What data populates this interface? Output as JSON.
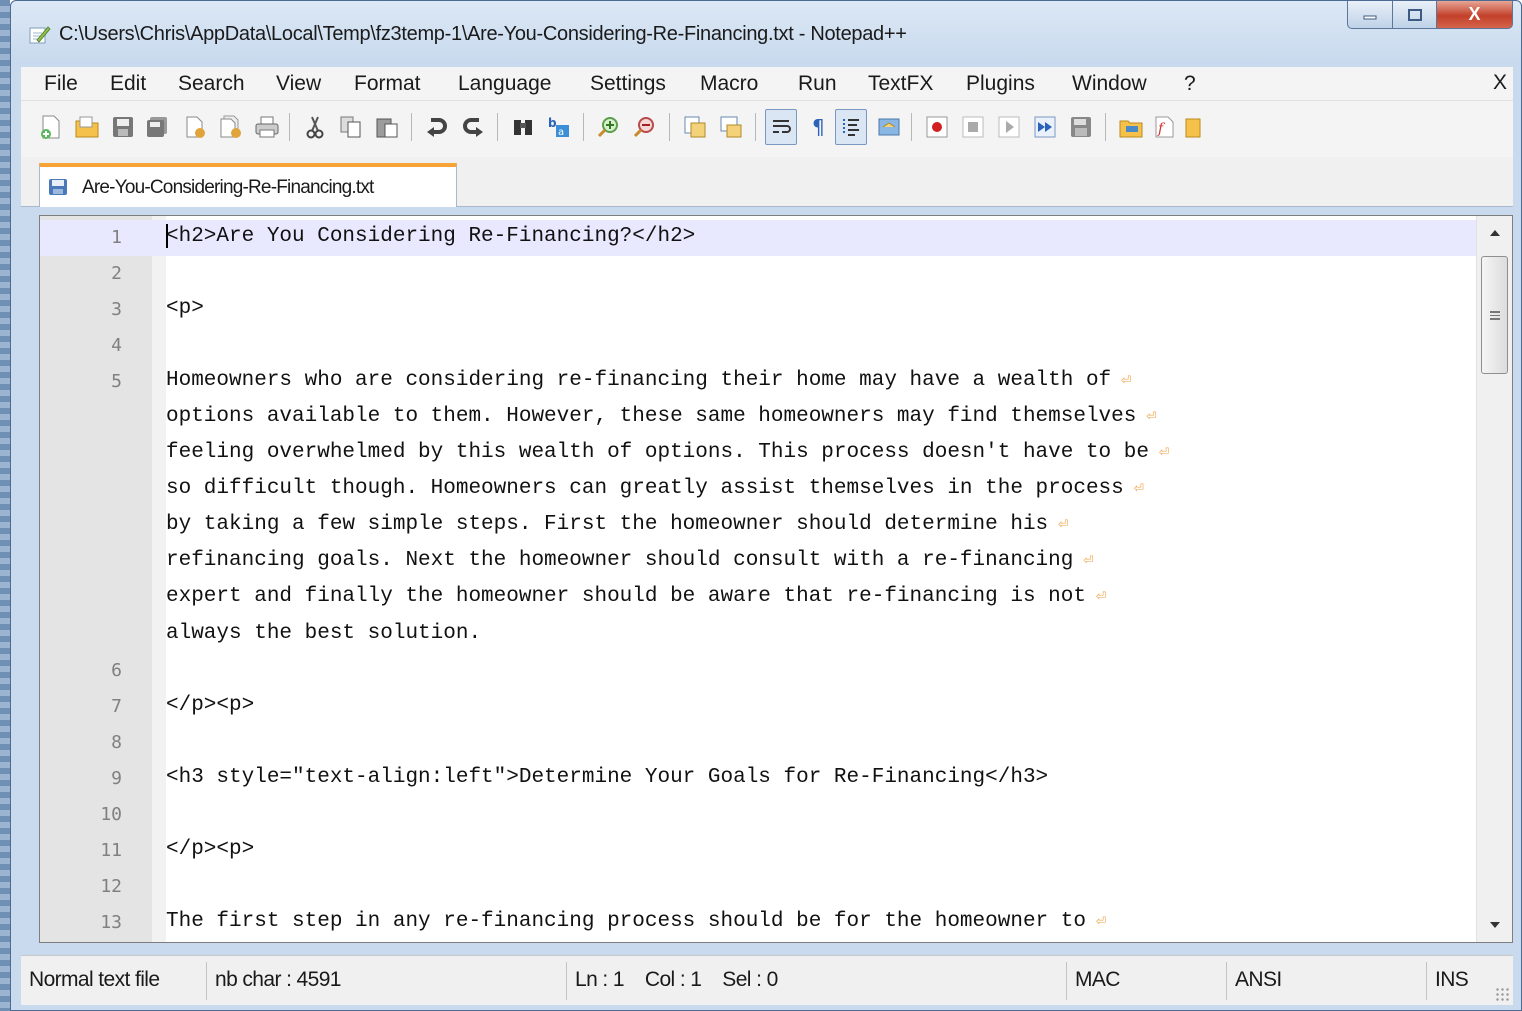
{
  "window": {
    "title": "C:\\Users\\Chris\\AppData\\Local\\Temp\\fz3temp-1\\Are-You-Considering-Re-Financing.txt - Notepad++",
    "controls": {
      "minimize": "▭",
      "maximize": "▢",
      "close": "X"
    }
  },
  "menu": {
    "items": [
      "File",
      "Edit",
      "Search",
      "View",
      "Format",
      "Language",
      "Settings",
      "Macro",
      "Run",
      "TextFX",
      "Plugins",
      "Window",
      "?"
    ],
    "close_label": "X"
  },
  "toolbar": {
    "buttons": [
      "new-file",
      "open-file",
      "save",
      "save-all",
      "close",
      "close-all",
      "print",
      "cut",
      "copy",
      "paste",
      "undo",
      "redo",
      "find",
      "replace",
      "zoom-in",
      "zoom-out",
      "sync-vertical",
      "sync-horizontal",
      "word-wrap",
      "show-all-chars",
      "indent-guide",
      "user-defined-language",
      "record-macro",
      "stop-recording",
      "playback-macro",
      "run-macro-multiple",
      "save-macro",
      "folder",
      "function-list",
      "more"
    ]
  },
  "tabs": [
    {
      "label": "Are-You-Considering-Re-Financing.txt",
      "active": true
    }
  ],
  "editor": {
    "lines": [
      {
        "num": "1",
        "text": "<h2>Are You Considering Re-Financing?</h2>",
        "wrap": false,
        "current": true
      },
      {
        "num": "2",
        "text": "",
        "wrap": false
      },
      {
        "num": "3",
        "text": "<p>",
        "wrap": false
      },
      {
        "num": "4",
        "text": "",
        "wrap": false
      },
      {
        "num": "5",
        "text": "Homeowners who are considering re-financing their home may have a wealth of",
        "wrap": true
      },
      {
        "num": "",
        "text": "options available to them. However, these same homeowners may find themselves",
        "wrap": true
      },
      {
        "num": "",
        "text": "feeling overwhelmed by this wealth of options. This process doesn't have to be",
        "wrap": true
      },
      {
        "num": "",
        "text": "so difficult though. Homeowners can greatly assist themselves in the process",
        "wrap": true
      },
      {
        "num": "",
        "text": "by taking a few simple steps. First the homeowner should determine his",
        "wrap": true
      },
      {
        "num": "",
        "text": "refinancing goals. Next the homeowner should consult with a re-financing",
        "wrap": true
      },
      {
        "num": "",
        "text": "expert and finally the homeowner should be aware that re-financing is not",
        "wrap": true
      },
      {
        "num": "",
        "text": "always the best solution.",
        "wrap": false
      },
      {
        "num": "6",
        "text": "",
        "wrap": false
      },
      {
        "num": "7",
        "text": "</p><p>",
        "wrap": false
      },
      {
        "num": "8",
        "text": "",
        "wrap": false
      },
      {
        "num": "9",
        "text": "<h3 style=\"text-align:left\">Determine Your Goals for Re-Financing</h3>",
        "wrap": false
      },
      {
        "num": "10",
        "text": "",
        "wrap": false
      },
      {
        "num": "11",
        "text": "</p><p>",
        "wrap": false
      },
      {
        "num": "12",
        "text": "",
        "wrap": false
      },
      {
        "num": "13",
        "text": "The first step in any re-financing process should be for the homeowner to",
        "wrap": true
      }
    ],
    "wrap_symbol": "⏎"
  },
  "status": {
    "file_type": "Normal text file",
    "nb_char": "nb char : 4591",
    "position": "Ln : 1    Col : 1    Sel : 0",
    "eol": "MAC",
    "encoding": "ANSI",
    "mode": "INS"
  },
  "colors": {
    "current_line": "#e8e8ff",
    "wrap_mark": "#f0a448",
    "tab_accent": "#f7a336",
    "close_button": "#c2402a"
  }
}
